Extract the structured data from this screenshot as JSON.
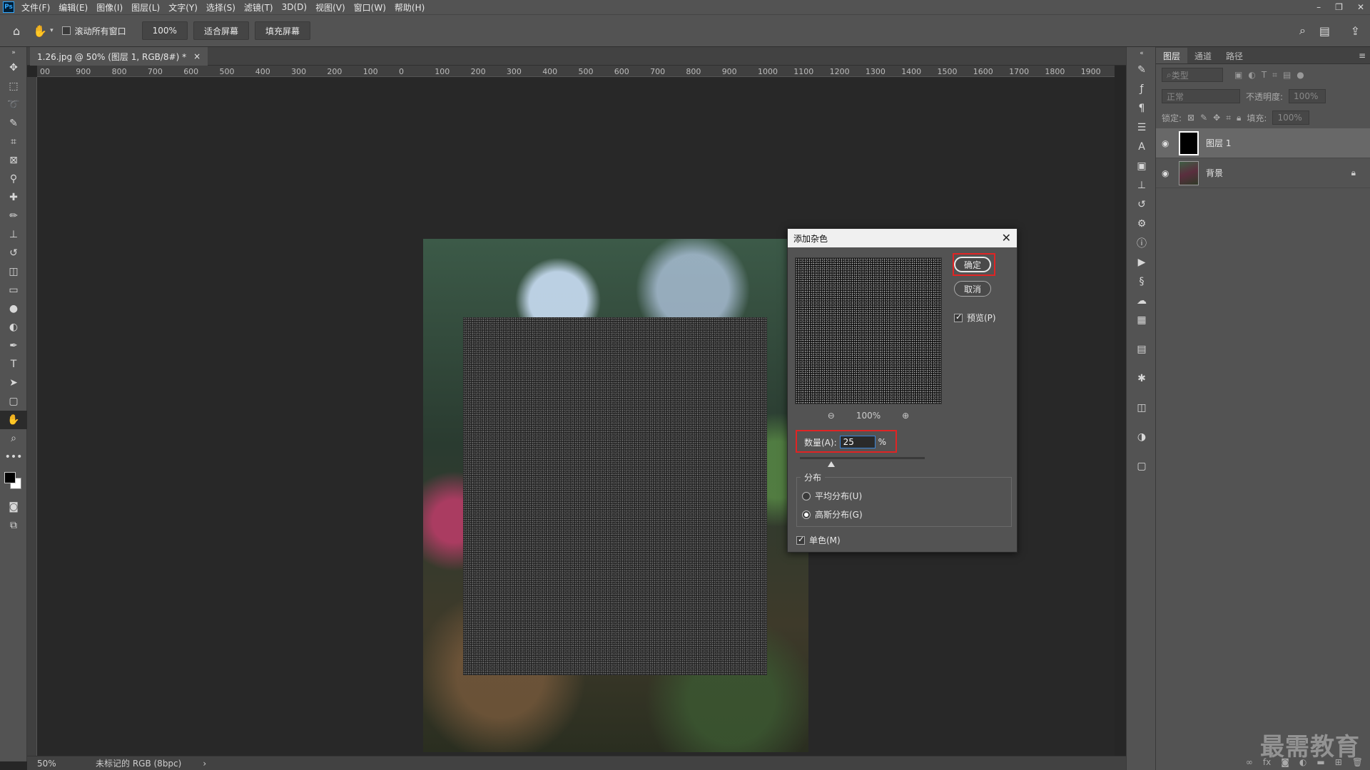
{
  "app": {
    "logo": "Ps"
  },
  "menu": [
    "文件(F)",
    "编辑(E)",
    "图像(I)",
    "图层(L)",
    "文字(Y)",
    "选择(S)",
    "滤镜(T)",
    "3D(D)",
    "视图(V)",
    "窗口(W)",
    "帮助(H)"
  ],
  "window_controls": {
    "minimize": "–",
    "restore": "❐",
    "close": "✕"
  },
  "options": {
    "scroll_all_label": "滚动所有窗口",
    "zoom_value": "100%",
    "fit_screen": "适合屏幕",
    "fill_screen": "填充屏幕"
  },
  "document": {
    "tab_title": "1.26.jpg @ 50% (图层 1, RGB/8#) *",
    "tab_close": "×"
  },
  "ruler_labels": [
    "00",
    "900",
    "800",
    "700",
    "600",
    "500",
    "400",
    "300",
    "200",
    "100",
    "0",
    "100",
    "200",
    "300",
    "400",
    "500",
    "600",
    "700",
    "800",
    "900",
    "1000",
    "1100",
    "1200",
    "1300",
    "1400",
    "1500",
    "1600",
    "1700",
    "1800",
    "1900",
    "200"
  ],
  "status": {
    "zoom": "50%",
    "info": "未标记的 RGB (8bpc)",
    "arrow": "›"
  },
  "layers_panel": {
    "tabs": [
      "图层",
      "通道",
      "路径"
    ],
    "filter_placeholder": "类型",
    "blend_mode": "正常",
    "opacity_label": "不透明度:",
    "opacity_value": "100%",
    "lock_label": "锁定:",
    "fill_label": "填充:",
    "fill_value": "100%",
    "layers": [
      {
        "name": "图层 1",
        "selected": true
      },
      {
        "name": "背景",
        "locked": true
      }
    ]
  },
  "dialog": {
    "title": "添加杂色",
    "close": "✕",
    "ok": "确定",
    "cancel": "取消",
    "preview_label": "预览(P)",
    "preview_checked": true,
    "zoom_value": "100%",
    "amount_label": "数量(A):",
    "amount_value": "25",
    "amount_unit": "%",
    "amount_slider_fraction": 0.25,
    "distribution_label": "分布",
    "uniform_label": "平均分布(U)",
    "gaussian_label": "高斯分布(G)",
    "selected_distribution": "gaussian",
    "mono_label": "单色(M)",
    "mono_checked": true
  },
  "watermark": "最需教育",
  "colors": {
    "highlight": "#e02424",
    "panel": "#535353",
    "canvas": "#282828"
  }
}
